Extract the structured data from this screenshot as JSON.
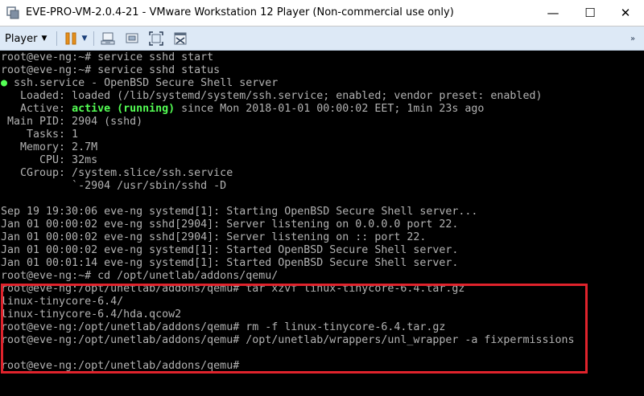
{
  "window": {
    "title": "EVE-PRO-VM-2.0.4-21 - VMware Workstation 12 Player (Non-commercial use only)",
    "minimize_glyph": "—",
    "maximize_glyph": "☐",
    "close_glyph": "✕"
  },
  "toolbar": {
    "player_label": "Player",
    "icons": [
      "pause-icon",
      "send-ctrl-alt-del-icon",
      "fit-guest-icon",
      "full-screen-icon",
      "unity-icon"
    ]
  },
  "terminal": {
    "lines": [
      {
        "text": "root@eve-ng:~# service sshd start"
      },
      {
        "text": "root@eve-ng:~# service sshd status"
      },
      {
        "prefix": "●",
        "text": " ssh.service - OpenBSD Secure Shell server"
      },
      {
        "text": "   Loaded: loaded (/lib/systemd/system/ssh.service; enabled; vendor preset: enabled)"
      },
      {
        "pre": "   Active: ",
        "status": "active (running)",
        "post": " since Mon 2018-01-01 00:00:02 EET; 1min 23s ago"
      },
      {
        "text": " Main PID: 2904 (sshd)"
      },
      {
        "text": "    Tasks: 1"
      },
      {
        "text": "   Memory: 2.7M"
      },
      {
        "text": "      CPU: 32ms"
      },
      {
        "text": "   CGroup: /system.slice/ssh.service"
      },
      {
        "text": "           `-2904 /usr/sbin/sshd -D"
      },
      {
        "text": ""
      },
      {
        "text": "Sep 19 19:30:06 eve-ng systemd[1]: Starting OpenBSD Secure Shell server..."
      },
      {
        "text": "Jan 01 00:00:02 eve-ng sshd[2904]: Server listening on 0.0.0.0 port 22."
      },
      {
        "text": "Jan 01 00:00:02 eve-ng sshd[2904]: Server listening on :: port 22."
      },
      {
        "text": "Jan 01 00:00:02 eve-ng systemd[1]: Started OpenBSD Secure Shell server."
      },
      {
        "text": "Jan 01 00:01:14 eve-ng systemd[1]: Started OpenBSD Secure Shell server."
      },
      {
        "text": "root@eve-ng:~# cd /opt/unetlab/addons/qemu/"
      },
      {
        "text": "root@eve-ng:/opt/unetlab/addons/qemu# tar xzvf linux-tinycore-6.4.tar.gz"
      },
      {
        "text": "linux-tinycore-6.4/"
      },
      {
        "text": "linux-tinycore-6.4/hda.qcow2"
      },
      {
        "text": "root@eve-ng:/opt/unetlab/addons/qemu# rm -f linux-tinycore-6.4.tar.gz"
      },
      {
        "text": "root@eve-ng:/opt/unetlab/addons/qemu# /opt/unetlab/wrappers/unl_wrapper -a fixpermissions"
      },
      {
        "text": ""
      },
      {
        "text": "root@eve-ng:/opt/unetlab/addons/qemu#"
      }
    ]
  },
  "colors": {
    "terminal_text": "#b2b2b2",
    "status_green": "#54ff54",
    "highlight_border": "#e0232c",
    "toolbar_bg": "#dde9f6"
  }
}
